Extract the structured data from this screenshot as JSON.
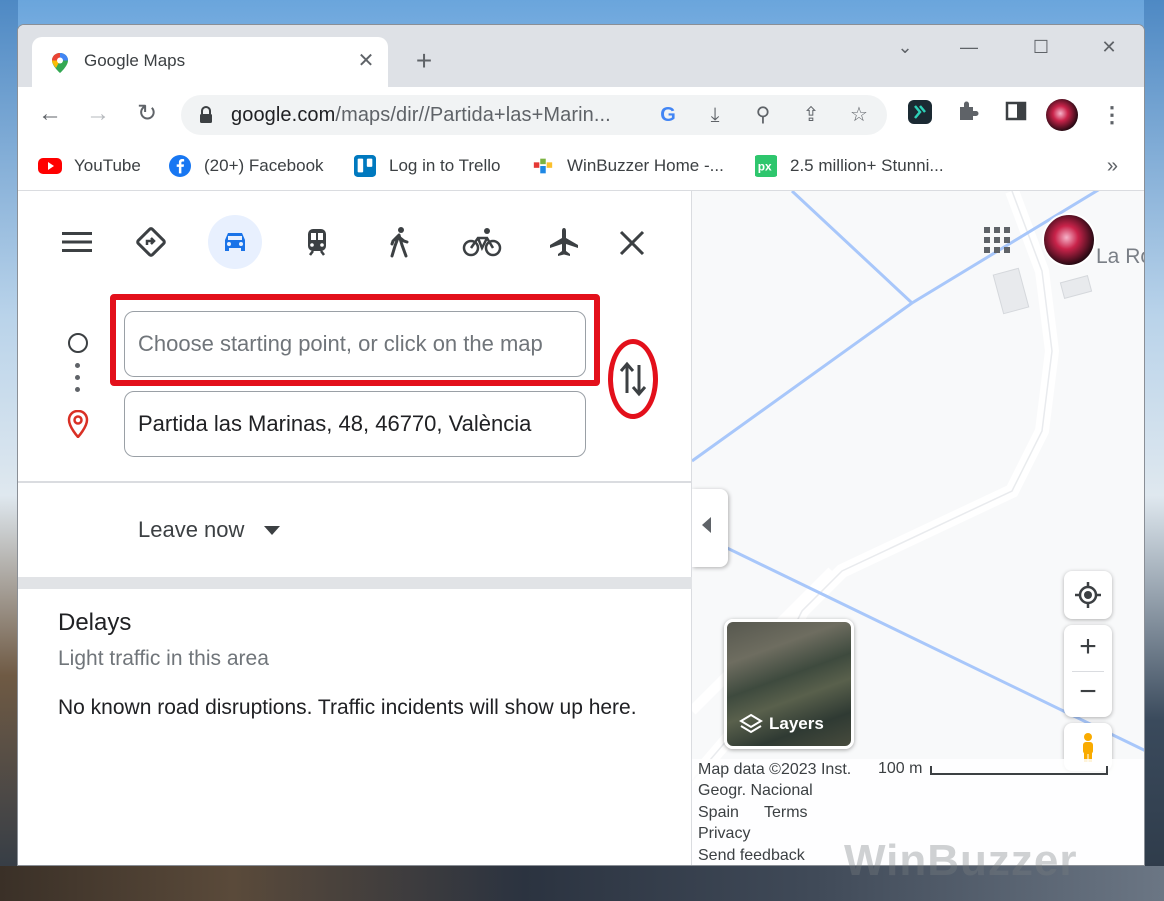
{
  "tab": {
    "title": "Google Maps"
  },
  "address_bar": {
    "url_host": "google.com",
    "url_path": "/maps/dir//Partida+las+Marin..."
  },
  "bookmarks": [
    {
      "label": "YouTube",
      "icon": "youtube-icon",
      "color": "#ff0000"
    },
    {
      "label": "(20+) Facebook",
      "icon": "facebook-icon",
      "color": "#1877f2"
    },
    {
      "label": "Log in to Trello",
      "icon": "trello-icon",
      "color": "#0079bf"
    },
    {
      "label": "WinBuzzer Home -...",
      "icon": "winbuzzer-icon",
      "color": "#7cb342"
    },
    {
      "label": "2.5 million+ Stunni...",
      "icon": "pixabay-icon",
      "color": "#2ec66d"
    }
  ],
  "directions": {
    "modes": [
      "best-route",
      "driving",
      "transit",
      "walking",
      "cycling",
      "flights"
    ],
    "active_mode": "driving",
    "start": {
      "value": "",
      "placeholder": "Choose starting point, or click on the map"
    },
    "destination": {
      "value": "Partida las Marinas, 48, 46770, València",
      "placeholder": ""
    },
    "leave_now_label": "Leave now"
  },
  "delays": {
    "title": "Delays",
    "subtitle": "Light traffic in this area",
    "body": "No known road disruptions. Traffic incidents will show up here."
  },
  "map": {
    "place_label": "La Ro",
    "layers_label": "Layers",
    "attribution": {
      "line1": "Map data ©2023 Inst.",
      "line2": "Geogr. Nacional",
      "line3a": "Spain",
      "line3b": "Terms",
      "line4": "Privacy",
      "line5": "Send feedback"
    },
    "scale_label": "100 m"
  },
  "watermark": "WinBuzzer",
  "colors": {
    "highlight": "#e3101b",
    "accent": "#1a73e8",
    "road": "#a8c7fa"
  }
}
